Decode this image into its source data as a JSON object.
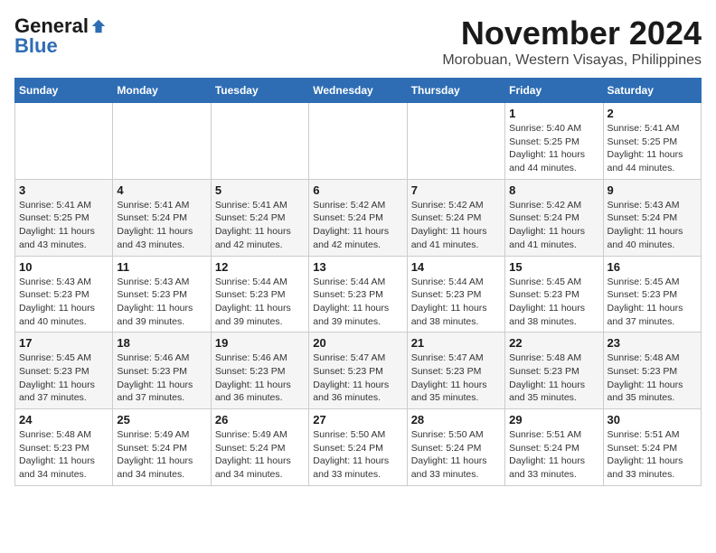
{
  "header": {
    "logo_general": "General",
    "logo_blue": "Blue",
    "month_title": "November 2024",
    "location": "Morobuan, Western Visayas, Philippines"
  },
  "weekdays": [
    "Sunday",
    "Monday",
    "Tuesday",
    "Wednesday",
    "Thursday",
    "Friday",
    "Saturday"
  ],
  "weeks": [
    [
      {
        "day": "",
        "info": ""
      },
      {
        "day": "",
        "info": ""
      },
      {
        "day": "",
        "info": ""
      },
      {
        "day": "",
        "info": ""
      },
      {
        "day": "",
        "info": ""
      },
      {
        "day": "1",
        "info": "Sunrise: 5:40 AM\nSunset: 5:25 PM\nDaylight: 11 hours and 44 minutes."
      },
      {
        "day": "2",
        "info": "Sunrise: 5:41 AM\nSunset: 5:25 PM\nDaylight: 11 hours and 44 minutes."
      }
    ],
    [
      {
        "day": "3",
        "info": "Sunrise: 5:41 AM\nSunset: 5:25 PM\nDaylight: 11 hours and 43 minutes."
      },
      {
        "day": "4",
        "info": "Sunrise: 5:41 AM\nSunset: 5:24 PM\nDaylight: 11 hours and 43 minutes."
      },
      {
        "day": "5",
        "info": "Sunrise: 5:41 AM\nSunset: 5:24 PM\nDaylight: 11 hours and 42 minutes."
      },
      {
        "day": "6",
        "info": "Sunrise: 5:42 AM\nSunset: 5:24 PM\nDaylight: 11 hours and 42 minutes."
      },
      {
        "day": "7",
        "info": "Sunrise: 5:42 AM\nSunset: 5:24 PM\nDaylight: 11 hours and 41 minutes."
      },
      {
        "day": "8",
        "info": "Sunrise: 5:42 AM\nSunset: 5:24 PM\nDaylight: 11 hours and 41 minutes."
      },
      {
        "day": "9",
        "info": "Sunrise: 5:43 AM\nSunset: 5:24 PM\nDaylight: 11 hours and 40 minutes."
      }
    ],
    [
      {
        "day": "10",
        "info": "Sunrise: 5:43 AM\nSunset: 5:23 PM\nDaylight: 11 hours and 40 minutes."
      },
      {
        "day": "11",
        "info": "Sunrise: 5:43 AM\nSunset: 5:23 PM\nDaylight: 11 hours and 39 minutes."
      },
      {
        "day": "12",
        "info": "Sunrise: 5:44 AM\nSunset: 5:23 PM\nDaylight: 11 hours and 39 minutes."
      },
      {
        "day": "13",
        "info": "Sunrise: 5:44 AM\nSunset: 5:23 PM\nDaylight: 11 hours and 39 minutes."
      },
      {
        "day": "14",
        "info": "Sunrise: 5:44 AM\nSunset: 5:23 PM\nDaylight: 11 hours and 38 minutes."
      },
      {
        "day": "15",
        "info": "Sunrise: 5:45 AM\nSunset: 5:23 PM\nDaylight: 11 hours and 38 minutes."
      },
      {
        "day": "16",
        "info": "Sunrise: 5:45 AM\nSunset: 5:23 PM\nDaylight: 11 hours and 37 minutes."
      }
    ],
    [
      {
        "day": "17",
        "info": "Sunrise: 5:45 AM\nSunset: 5:23 PM\nDaylight: 11 hours and 37 minutes."
      },
      {
        "day": "18",
        "info": "Sunrise: 5:46 AM\nSunset: 5:23 PM\nDaylight: 11 hours and 37 minutes."
      },
      {
        "day": "19",
        "info": "Sunrise: 5:46 AM\nSunset: 5:23 PM\nDaylight: 11 hours and 36 minutes."
      },
      {
        "day": "20",
        "info": "Sunrise: 5:47 AM\nSunset: 5:23 PM\nDaylight: 11 hours and 36 minutes."
      },
      {
        "day": "21",
        "info": "Sunrise: 5:47 AM\nSunset: 5:23 PM\nDaylight: 11 hours and 35 minutes."
      },
      {
        "day": "22",
        "info": "Sunrise: 5:48 AM\nSunset: 5:23 PM\nDaylight: 11 hours and 35 minutes."
      },
      {
        "day": "23",
        "info": "Sunrise: 5:48 AM\nSunset: 5:23 PM\nDaylight: 11 hours and 35 minutes."
      }
    ],
    [
      {
        "day": "24",
        "info": "Sunrise: 5:48 AM\nSunset: 5:23 PM\nDaylight: 11 hours and 34 minutes."
      },
      {
        "day": "25",
        "info": "Sunrise: 5:49 AM\nSunset: 5:24 PM\nDaylight: 11 hours and 34 minutes."
      },
      {
        "day": "26",
        "info": "Sunrise: 5:49 AM\nSunset: 5:24 PM\nDaylight: 11 hours and 34 minutes."
      },
      {
        "day": "27",
        "info": "Sunrise: 5:50 AM\nSunset: 5:24 PM\nDaylight: 11 hours and 33 minutes."
      },
      {
        "day": "28",
        "info": "Sunrise: 5:50 AM\nSunset: 5:24 PM\nDaylight: 11 hours and 33 minutes."
      },
      {
        "day": "29",
        "info": "Sunrise: 5:51 AM\nSunset: 5:24 PM\nDaylight: 11 hours and 33 minutes."
      },
      {
        "day": "30",
        "info": "Sunrise: 5:51 AM\nSunset: 5:24 PM\nDaylight: 11 hours and 33 minutes."
      }
    ]
  ]
}
